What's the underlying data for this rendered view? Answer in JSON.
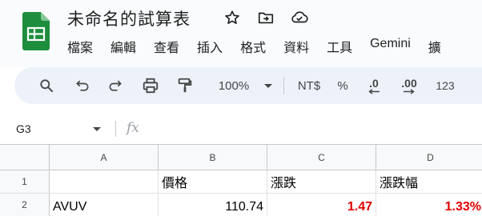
{
  "app": {
    "doc_title": "未命名的試算表",
    "brand_color": "#1e8e3e"
  },
  "title_icons": [
    "star-icon",
    "move-to-folder-icon",
    "cloud-status-icon"
  ],
  "menu": {
    "items": [
      "檔案",
      "編輯",
      "查看",
      "插入",
      "格式",
      "資料",
      "工具",
      "Gemini",
      "擴"
    ]
  },
  "toolbar": {
    "icons": [
      "search-icon",
      "undo-icon",
      "redo-icon",
      "print-icon",
      "paint-format-icon"
    ],
    "zoom": "100%",
    "currency": "NT$",
    "percent": "%",
    "decrease_decimal": ".0",
    "increase_decimal": ".00",
    "number_format": "123"
  },
  "formula_bar": {
    "name_box": "G3",
    "fx": "fx",
    "value": ""
  },
  "sheet": {
    "columns": [
      "A",
      "B",
      "C",
      "D"
    ],
    "rows": [
      {
        "num": "1",
        "cells": [
          "",
          "價格",
          "漲跌",
          "漲跌幅"
        ]
      },
      {
        "num": "2",
        "cells": [
          "AVUV",
          "110.74",
          "1.47",
          "1.33%"
        ]
      }
    ],
    "negative_color": "#e00000"
  }
}
